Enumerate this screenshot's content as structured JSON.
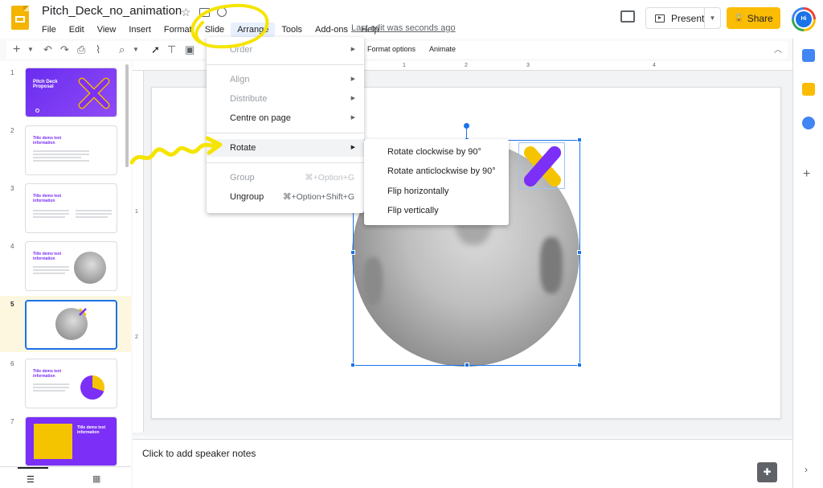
{
  "doc": {
    "title": "Pitch_Deck_no_animation"
  },
  "menubar": {
    "items": [
      "File",
      "Edit",
      "View",
      "Insert",
      "Format",
      "Slide",
      "Arrange",
      "Tools",
      "Add-ons",
      "Help"
    ],
    "last_edit": "Last edit was seconds ago"
  },
  "header": {
    "present_label": "Present",
    "share_label": "Share",
    "avatar_initials": "Hi"
  },
  "toolbar": {
    "format_options": "Format options",
    "animate": "Animate"
  },
  "ruler": {
    "marks": [
      "1",
      "2",
      "3",
      "4"
    ],
    "left_marks": [
      "1",
      "2"
    ]
  },
  "filmstrip": {
    "slides": [
      {
        "num": "1",
        "title": "Pitch Deck Proposal"
      },
      {
        "num": "2",
        "title": "Title demo text information"
      },
      {
        "num": "3",
        "title": "Title demo text information"
      },
      {
        "num": "4",
        "title": "Title demo text information"
      },
      {
        "num": "5",
        "title": ""
      },
      {
        "num": "6",
        "title": "Title demo text information"
      },
      {
        "num": "7",
        "title": "Title demo text information"
      }
    ],
    "selected": "5"
  },
  "notes": {
    "placeholder": "Click to add speaker notes"
  },
  "arrange_menu": {
    "items": [
      {
        "label": "Order",
        "disabled": true,
        "submenu": true
      },
      {
        "label": "Align",
        "disabled": true,
        "submenu": true
      },
      {
        "label": "Distribute",
        "disabled": true,
        "submenu": true
      },
      {
        "label": "Centre on page",
        "disabled": false,
        "submenu": true
      },
      {
        "label": "Rotate",
        "disabled": false,
        "submenu": true,
        "highlighted": true
      },
      {
        "label": "Group",
        "disabled": true,
        "shortcut": "⌘+Option+G"
      },
      {
        "label": "Ungroup",
        "disabled": false,
        "shortcut": "⌘+Option+Shift+G"
      }
    ]
  },
  "rotate_submenu": {
    "items": [
      "Rotate clockwise by 90°",
      "Rotate anticlockwise by 90°",
      "Flip horizontally",
      "Flip vertically"
    ]
  },
  "colors": {
    "accent": "#1a73e8",
    "share": "#fbbc04",
    "brand_purple": "#7b2ff7",
    "annotation_yellow": "#f5e400"
  }
}
